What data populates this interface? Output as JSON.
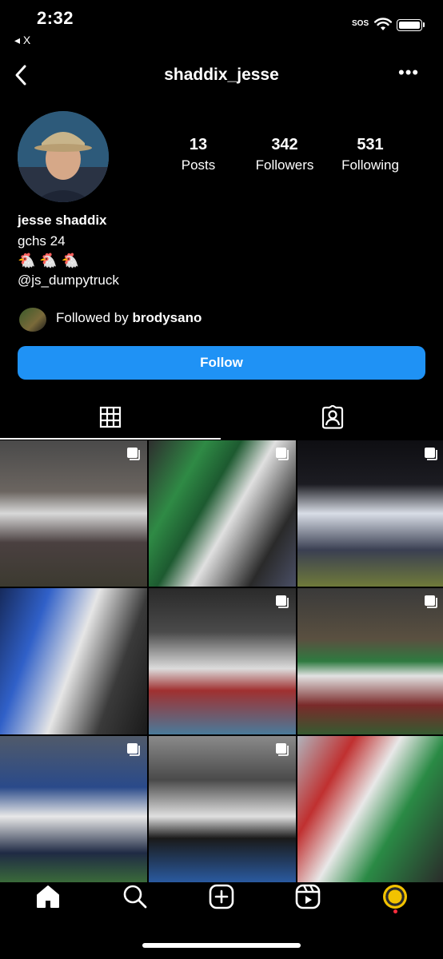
{
  "status_bar": {
    "time": "2:32",
    "back_to_app": "◂ X",
    "sos": "SOS"
  },
  "header": {
    "username": "shaddix_jesse",
    "more": "•••"
  },
  "profile": {
    "stats": [
      {
        "value": "13",
        "label": "Posts"
      },
      {
        "value": "342",
        "label": "Followers"
      },
      {
        "value": "531",
        "label": "Following"
      }
    ],
    "display_name": "jesse shaddix",
    "bio": [
      "gchs 24",
      "🐔 🐔 🐔",
      "@js_dumpytruck"
    ],
    "followed_by_prefix": "Followed by ",
    "followed_by_user": "brodysano",
    "follow_label": "Follow"
  },
  "tabs": [
    {
      "icon": "grid-icon",
      "active": true
    },
    {
      "icon": "tagged-icon",
      "active": false
    }
  ],
  "posts": [
    {
      "subject": "football-team-lineup",
      "multi": true
    },
    {
      "subject": "football-blocking",
      "multi": true
    },
    {
      "subject": "football-players-standing",
      "multi": true
    },
    {
      "subject": "football-lineman-76",
      "multi": false
    },
    {
      "subject": "football-pileup",
      "multi": true
    },
    {
      "subject": "football-tackle",
      "multi": true
    },
    {
      "subject": "football-sideline",
      "multi": true
    },
    {
      "subject": "football-huddle-referee",
      "multi": true
    },
    {
      "subject": "football-lineman-79",
      "multi": false
    }
  ],
  "colors": {
    "background": "#000000",
    "follow_button": "#1f92f5",
    "notification_dot": "#ff2d3d"
  },
  "bottom_nav": [
    "home-icon",
    "search-icon",
    "create-icon",
    "reels-icon",
    "profile-avatar"
  ]
}
